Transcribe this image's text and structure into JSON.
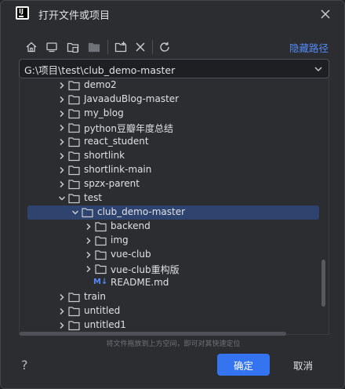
{
  "window": {
    "title": "打开文件或项目"
  },
  "toolbar": {
    "icons": [
      "home-icon",
      "desktop-icon",
      "project-folder-icon",
      "module-folder-icon",
      "new-folder-icon",
      "delete-icon",
      "refresh-icon"
    ],
    "hide_path_label": "隐藏路径"
  },
  "path": {
    "value": "G:\\项目\\test\\club_demo-master"
  },
  "tree": {
    "items": [
      {
        "label": "demo2",
        "expanded": false,
        "level": 0,
        "selected": false
      },
      {
        "label": "JavaaduBlog-master",
        "expanded": false,
        "level": 0,
        "selected": false
      },
      {
        "label": "my_blog",
        "expanded": false,
        "level": 0,
        "selected": false
      },
      {
        "label": "python豆瓣年度总结",
        "expanded": false,
        "level": 0,
        "selected": false
      },
      {
        "label": "react_student",
        "expanded": false,
        "level": 0,
        "selected": false
      },
      {
        "label": "shortlink",
        "expanded": false,
        "level": 0,
        "selected": false
      },
      {
        "label": "shortlink-main",
        "expanded": false,
        "level": 0,
        "selected": false
      },
      {
        "label": "spzx-parent",
        "expanded": false,
        "level": 0,
        "selected": false
      },
      {
        "label": "test",
        "expanded": true,
        "level": 0,
        "selected": false
      },
      {
        "label": "club_demo-master",
        "expanded": true,
        "level": 1,
        "selected": true
      },
      {
        "label": "backend",
        "expanded": false,
        "level": 2,
        "selected": false
      },
      {
        "label": "img",
        "expanded": false,
        "level": 2,
        "selected": false
      },
      {
        "label": "vue-club",
        "expanded": false,
        "level": 2,
        "selected": false
      },
      {
        "label": "vue-club重构版",
        "expanded": false,
        "level": 2,
        "selected": false
      },
      {
        "label": "README.md",
        "file": true,
        "level": 2,
        "selected": false
      },
      {
        "label": "train",
        "expanded": false,
        "level": 0,
        "selected": false
      },
      {
        "label": "untitled",
        "expanded": false,
        "level": 0,
        "selected": false
      },
      {
        "label": "untitled1",
        "expanded": false,
        "level": 0,
        "selected": false
      }
    ]
  },
  "drag_hint": "将文件拖放到上方空间，即可对其快速定位",
  "footer": {
    "help": "?",
    "ok_label": "确定",
    "cancel_label": "取消"
  },
  "colors": {
    "accent": "#3574f0",
    "link": "#548af7",
    "selection": "#2e436e",
    "background": "#2b2d30"
  }
}
